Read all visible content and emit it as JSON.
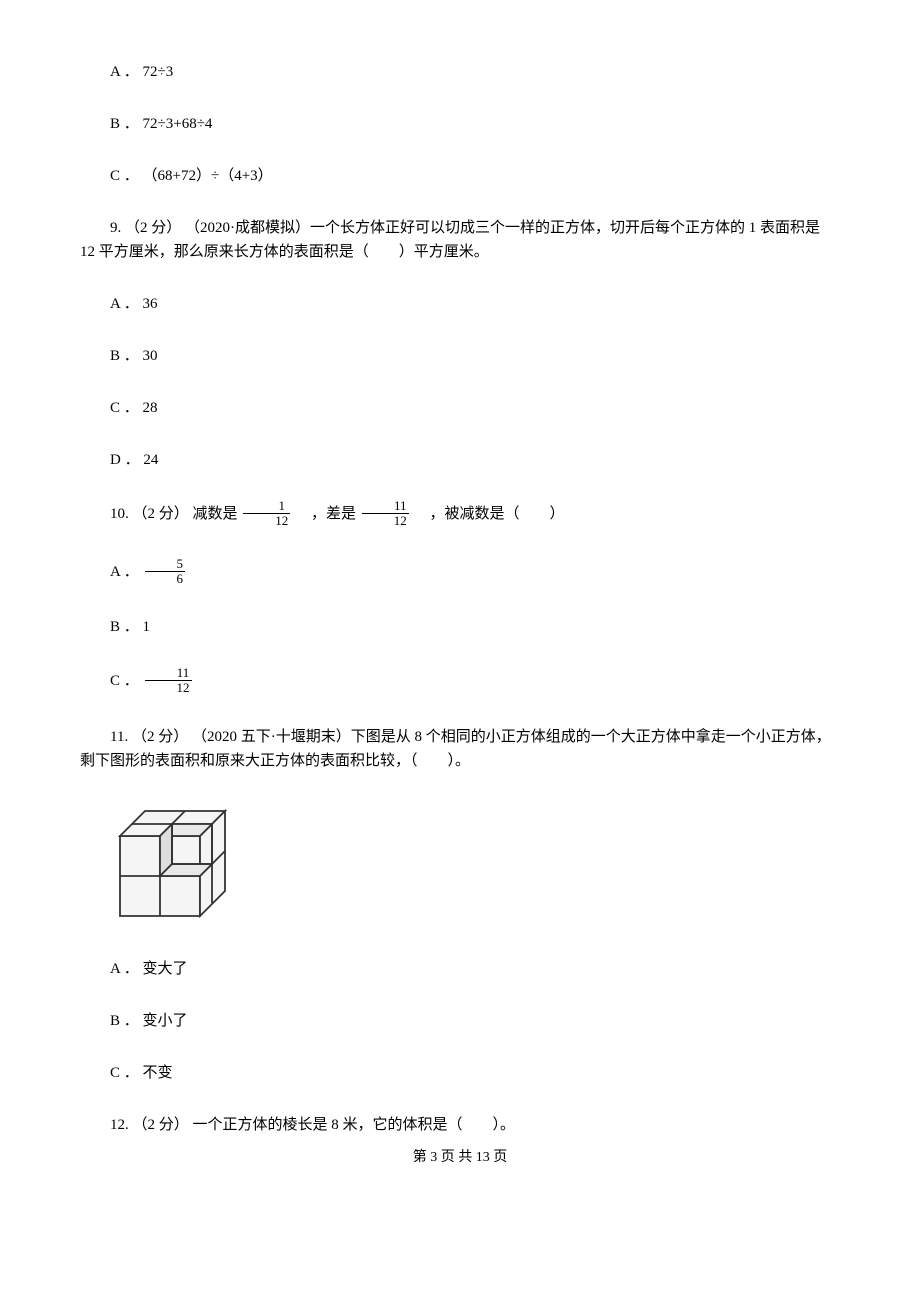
{
  "q8": {
    "optA": "A ． 72÷3",
    "optB": "B ． 72÷3+68÷4",
    "optC": "C ． （68+72）÷（4+3）"
  },
  "q9": {
    "line1": "9. （2 分） （2020·成都模拟）一个长方体正好可以切成三个一样的正方体，切开后每个正方体的 1 表面积是",
    "line2": "12 平方厘米，那么原来长方体的表面积是（　　）平方厘米。",
    "optA": "A ． 36",
    "optB": "B ． 30",
    "optC": "C ． 28",
    "optD": "D ． 24"
  },
  "q10": {
    "stem_pre": "10. （2 分）  减数是 ",
    "frac1_num": "1",
    "frac1_den": "12",
    "stem_mid": "　，差是 ",
    "frac2_num": "11",
    "frac2_den": "12",
    "stem_post": "　，被减数是（　　）",
    "optA_pre": "A ． ",
    "optA_num": "5",
    "optA_den": "6",
    "optB": "B ． 1",
    "optC_pre": "C ． ",
    "optC_num": "11",
    "optC_den": "12"
  },
  "q11": {
    "line1": "11. （2 分） （2020 五下·十堰期末）下图是从 8 个相同的小正方体组成的一个大正方体中拿走一个小正方体，",
    "line2": "剩下图形的表面积和原来大正方体的表面积比较，（　　）。",
    "optA": "A ． 变大了",
    "optB": "B ． 变小了",
    "optC": "C ． 不变"
  },
  "q12": {
    "stem": "12. （2 分）  一个正方体的棱长是 8 米，它的体积是（　　）。"
  },
  "footer": "第 3 页 共 13 页"
}
